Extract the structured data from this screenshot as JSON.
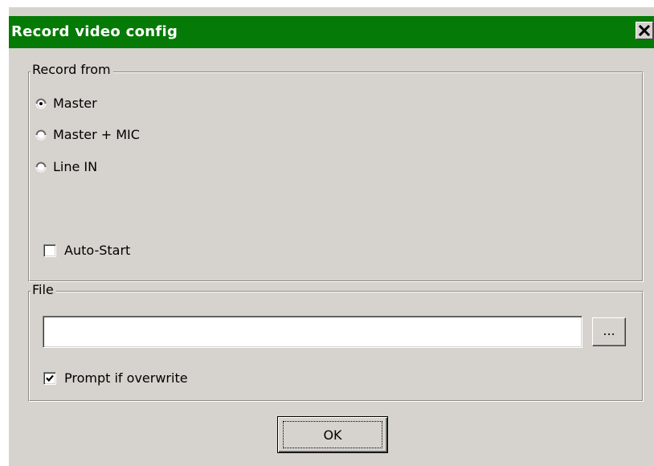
{
  "window": {
    "title": "Record video config",
    "close_label": "×",
    "titlebar_color": "#067a06",
    "face_color": "#d6d3ce"
  },
  "record_from": {
    "legend": "Record from",
    "options": [
      {
        "label": "Master",
        "selected": true
      },
      {
        "label": "Master + MIC",
        "selected": false
      },
      {
        "label": "Line IN",
        "selected": false
      }
    ],
    "auto_start": {
      "label": "Auto-Start",
      "checked": false
    }
  },
  "file": {
    "legend": "File",
    "path_value": "",
    "browse_label": "...",
    "prompt_overwrite": {
      "label": "Prompt if overwrite",
      "checked": true
    }
  },
  "footer": {
    "ok_label": "OK"
  },
  "icons": {
    "close": "close-icon",
    "radio_on": "radio-selected-icon",
    "radio_off": "radio-unselected-icon",
    "check": "checkmark-icon"
  }
}
